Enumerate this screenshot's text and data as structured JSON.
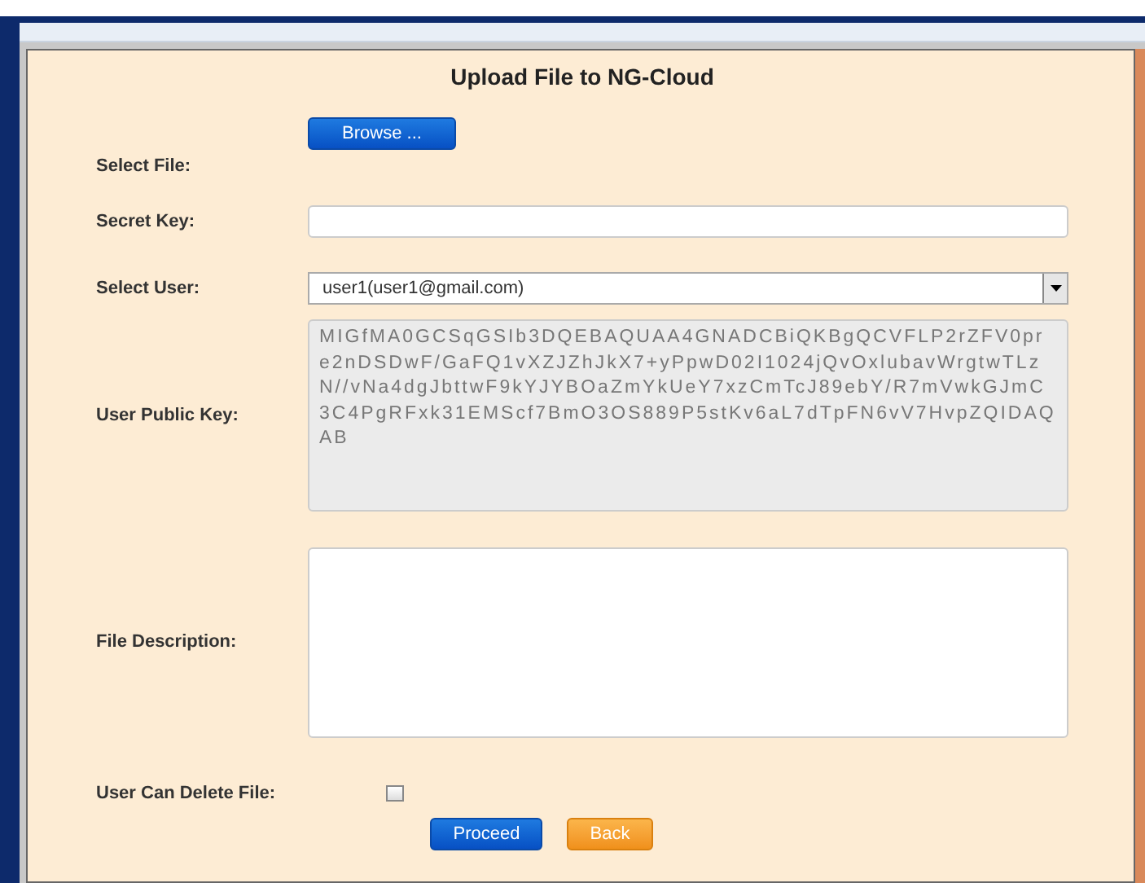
{
  "title": "Upload File to NG-Cloud",
  "select_file": {
    "label": "Select File:",
    "button": "Browse ..."
  },
  "secret_key": {
    "label": "Secret Key:"
  },
  "select_user": {
    "label": "Select User:",
    "value": "user1(user1@gmail.com)"
  },
  "public_key": {
    "label": "User Public Key:",
    "value": "MIGfMA0GCSqGSIb3DQEBAQUAA4GNADCBiQKBgQCVFLP2rZFV0pre2nDSDwF/GaFQ1vXZJZhJkX7+yPpwD02I1024jQvOxlubavWrgtwTLzN//vNa4dgJbttwF9kYJYBOaZmYkUeY7xzCmTcJ89ebY/R7mVwkGJmC3C4PgRFxk31EMScf7BmO3OS889P5stKv6aL7dTpFN6vV7HvpZQIDAQAB",
    "disabled": true
  },
  "file_description": {
    "label": "File Description:"
  },
  "delete_file": {
    "label": "User Can Delete File:",
    "checked": false
  },
  "buttons": [
    {
      "label": "Proceed",
      "kind": "primary"
    },
    {
      "label": "Back",
      "kind": "secondary"
    }
  ]
}
